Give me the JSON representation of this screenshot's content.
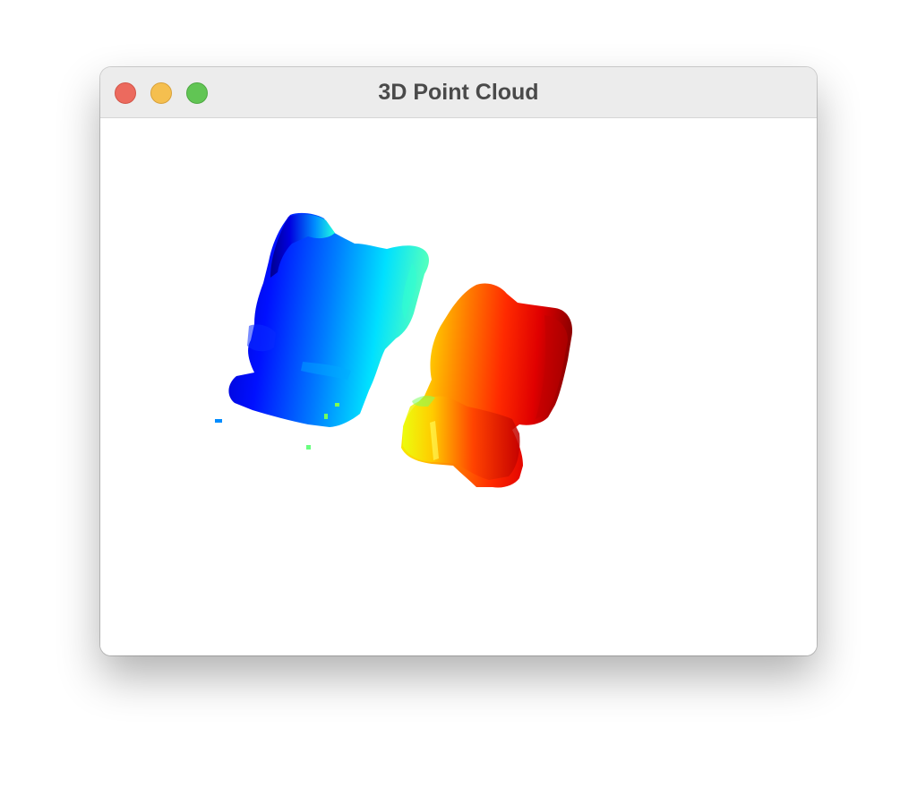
{
  "window": {
    "title": "3D Point Cloud",
    "controls": {
      "close": "close-button",
      "minimize": "minimize-button",
      "zoom": "zoom-button"
    }
  },
  "point_cloud": {
    "colormap": "jet",
    "colormap_stops": [
      "#00008f",
      "#0000ff",
      "#00ffff",
      "#ffff00",
      "#ff0000",
      "#800000"
    ],
    "background": "#ffffff",
    "objects": [
      "left-object",
      "right-object"
    ]
  }
}
